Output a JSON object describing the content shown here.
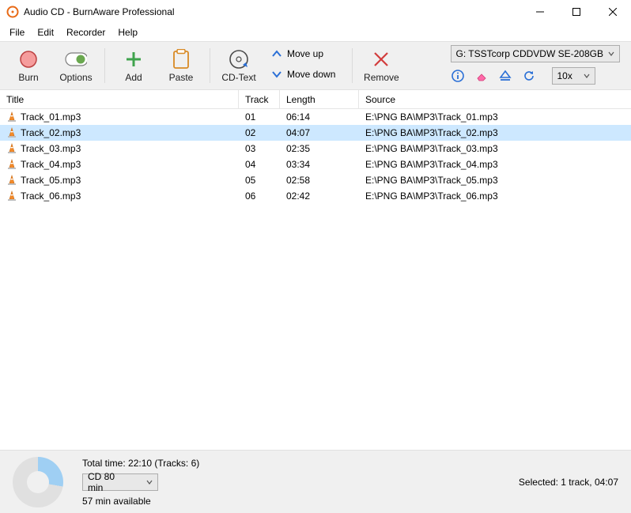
{
  "window": {
    "title": "Audio CD - BurnAware Professional"
  },
  "menu": {
    "file": "File",
    "edit": "Edit",
    "recorder": "Recorder",
    "help": "Help"
  },
  "toolbar": {
    "burn": "Burn",
    "options": "Options",
    "add": "Add",
    "paste": "Paste",
    "cdtext": "CD-Text",
    "moveup": "Move up",
    "movedown": "Move down",
    "remove": "Remove",
    "drive": "G: TSSTcorp CDDVDW SE-208GB",
    "speed": "10x"
  },
  "columns": {
    "title": "Title",
    "track": "Track",
    "length": "Length",
    "source": "Source"
  },
  "rows": [
    {
      "title": "Track_01.mp3",
      "track": "01",
      "length": "06:14",
      "source": "E:\\PNG BA\\MP3\\Track_01.mp3",
      "selected": false
    },
    {
      "title": "Track_02.mp3",
      "track": "02",
      "length": "04:07",
      "source": "E:\\PNG BA\\MP3\\Track_02.mp3",
      "selected": true
    },
    {
      "title": "Track_03.mp3",
      "track": "03",
      "length": "02:35",
      "source": "E:\\PNG BA\\MP3\\Track_03.mp3",
      "selected": false
    },
    {
      "title": "Track_04.mp3",
      "track": "04",
      "length": "03:34",
      "source": "E:\\PNG BA\\MP3\\Track_04.mp3",
      "selected": false
    },
    {
      "title": "Track_05.mp3",
      "track": "05",
      "length": "02:58",
      "source": "E:\\PNG BA\\MP3\\Track_05.mp3",
      "selected": false
    },
    {
      "title": "Track_06.mp3",
      "track": "06",
      "length": "02:42",
      "source": "E:\\PNG BA\\MP3\\Track_06.mp3",
      "selected": false
    }
  ],
  "footer": {
    "total": "Total time: 22:10 (Tracks: 6)",
    "disc": "CD 80 min",
    "available": "57 min available",
    "selected": "Selected: 1 track, 04:07"
  }
}
